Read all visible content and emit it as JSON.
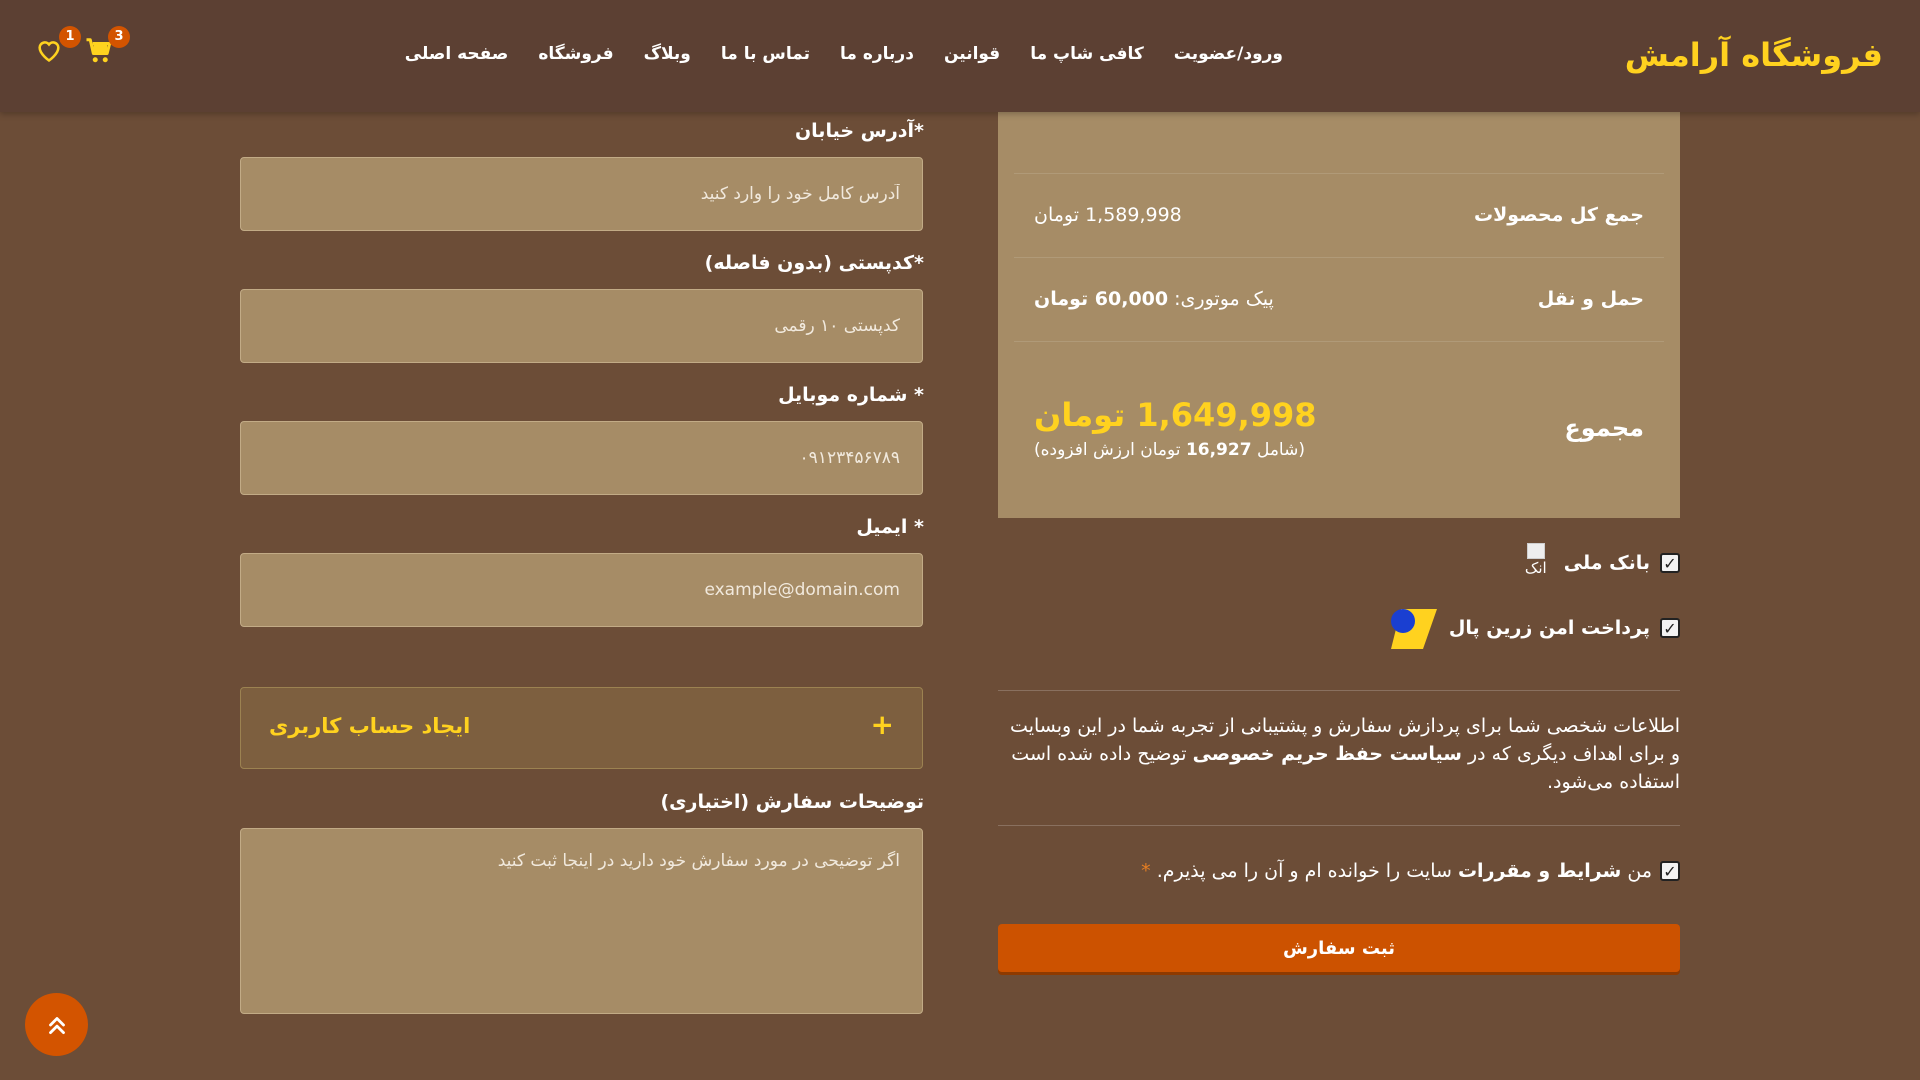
{
  "header": {
    "brand": "فروشگاه آرامش",
    "nav": [
      "صفحه اصلی",
      "فروشگاه",
      "وبلاگ",
      "تماس با ما",
      "درباره ما",
      "قوانین",
      "کافی شاپ ما",
      "ورود/عضویت"
    ],
    "cart_count": "3",
    "wishlist_count": "1",
    "icons": [
      "cart-icon",
      "heart-icon"
    ]
  },
  "summary": {
    "subtotal_label": "جمع کل محصولات",
    "subtotal_value": "1,589,998 تومان",
    "shipping_label": "حمل و نقل",
    "shipping_method": "پیک موتوری: ",
    "shipping_value": "60,000 تومان",
    "total_label": "مجموع",
    "total_value": "1,649,998 تومان",
    "tax_open": "(شامل ",
    "tax_value": "16,927",
    "tax_close": " تومان ارزش افزوده)"
  },
  "payment": {
    "option1_label": "بانک ملی",
    "option1_img_alt": "انک",
    "option2_label": "پرداخت امن زرین پال"
  },
  "privacy": {
    "text_start": "اطلاعات شخصی شما برای پردازش سفارش و پشتیبانی از تجربه شما در این وبسایت و برای اهداف دیگری که در ",
    "link": "سیاست حفظ حریم خصوصی",
    "text_end": " توضیح داده شده است استفاده می‌شود."
  },
  "terms": {
    "prefix": "من ",
    "link": "شرایط و مقررات",
    "suffix": " سایت را خوانده ام و آن را می پذیرم.",
    "required": "*"
  },
  "submit_label": "ثبت سفارش",
  "form": {
    "address_label": "*آدرس خیابان",
    "address_placeholder": "آدرس کامل خود را وارد کنید",
    "postcode_label": "*کدپستی (بدون فاصله)",
    "postcode_placeholder": "کدپستی ۱۰ رقمی",
    "mobile_label": "* شماره موبایل",
    "mobile_placeholder": "۰۹۱۲۳۴۵۶۷۸۹",
    "email_label": "* ایمیل",
    "email_placeholder": "example@domain.com",
    "create_account": "ایجاد حساب کاربری",
    "create_account_icon": "+",
    "notes_label": "توضیحات سفارش (اختیاری)",
    "notes_placeholder": "اگر توضیحی در مورد سفارش خود دارید در اینجا ثبت کنید"
  },
  "colors": {
    "brand": "#ffd21f",
    "accent": "#cc5200",
    "background": "#6c4d37",
    "header": "#5c4033"
  }
}
